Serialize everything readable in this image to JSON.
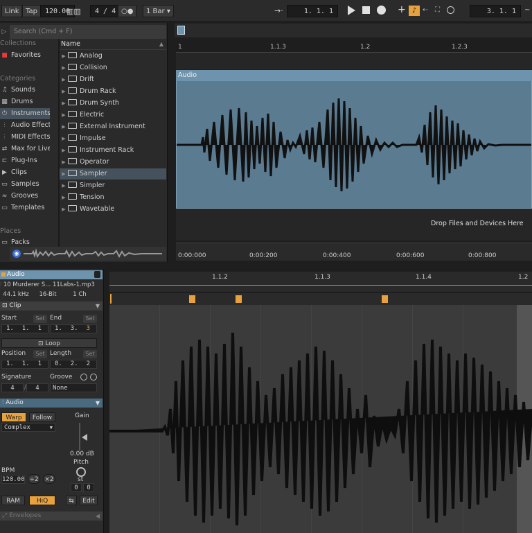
{
  "topbar": {
    "link": "Link",
    "tap": "Tap",
    "tempo": "120.00",
    "signature": "4 / 4",
    "metronome": "○●",
    "quantize": "1 Bar",
    "position": "1.   1.   1",
    "loop_end": "3.   1.   1"
  },
  "browser": {
    "search_placeholder": "Search (Cmd + F)",
    "collections_header": "Collections",
    "favorites": "Favorites",
    "categories_header": "Categories",
    "categories": [
      {
        "label": "Sounds",
        "icon": "♫"
      },
      {
        "label": "Drums",
        "icon": "▦"
      },
      {
        "label": "Instruments",
        "icon": "⏻"
      },
      {
        "label": "Audio Effects",
        "icon": "⫶"
      },
      {
        "label": "MIDI Effects",
        "icon": "⫶"
      },
      {
        "label": "Max for Live",
        "icon": "⇄"
      },
      {
        "label": "Plug-Ins",
        "icon": "⊏"
      },
      {
        "label": "Clips",
        "icon": "▶"
      },
      {
        "label": "Samples",
        "icon": "▭"
      },
      {
        "label": "Grooves",
        "icon": "≈"
      },
      {
        "label": "Templates",
        "icon": "▭"
      }
    ],
    "places_header": "Places",
    "places": [
      {
        "label": "Packs",
        "icon": "▭"
      }
    ],
    "name_header": "Name",
    "items": [
      "Analog",
      "Collision",
      "Drift",
      "Drum Rack",
      "Drum Synth",
      "Electric",
      "External Instrument",
      "Impulse",
      "Instrument Rack",
      "Operator",
      "Sampler",
      "Simpler",
      "Tension",
      "Wavetable"
    ],
    "selected_item": "Sampler"
  },
  "arrangement": {
    "ruler_marks": [
      "1",
      "1.1.3",
      "1.2",
      "1.2.3"
    ],
    "clip_name": "Audio",
    "drop_hint": "Drop Files and Devices Here",
    "time_marks": [
      "0:00:000",
      "0:00:200",
      "0:00:400",
      "0:00:600",
      "0:00:800"
    ]
  },
  "clip_detail": {
    "track_name": "Audio",
    "file_name": "10 Murderer S... 11Labs-1.mp3",
    "sample_rate": "44.1 kHz",
    "bit_depth": "16-Bit",
    "channels": "1 Ch",
    "clip_section": "Clip",
    "start_label": "Start",
    "end_label": "End",
    "set": "Set",
    "start_value": [
      "1.",
      "1.",
      "1"
    ],
    "end_value": [
      "1.",
      "3.",
      "3"
    ],
    "loop_label": "Loop",
    "position_label": "Position",
    "length_label": "Length",
    "position_value": [
      "1.",
      "1.",
      "1"
    ],
    "length_value": [
      "0.",
      "2.",
      "2"
    ],
    "signature_label": "Signature",
    "groove_label": "Groove",
    "sig_num": "4",
    "sig_den": "4",
    "groove_value": "None",
    "audio_section": "Audio",
    "warp": "Warp",
    "follow": "Follow",
    "warp_mode": "Complex",
    "gain_label": "Gain",
    "gain_value": "0.00 dB",
    "pitch_label": "Pitch",
    "pitch_unit": "st",
    "pitch_values": [
      "0",
      "0"
    ],
    "bpm_label": "BPM",
    "bpm_value": "120.00",
    "half": "÷2",
    "double": "×2",
    "ram": "RAM",
    "hiq": "HiQ",
    "edit": "Edit",
    "envelopes": "Envelopes"
  },
  "sample_editor": {
    "ruler_marks": [
      "1.1.2",
      "1.1.3",
      "1.1.4",
      "1.2"
    ]
  }
}
